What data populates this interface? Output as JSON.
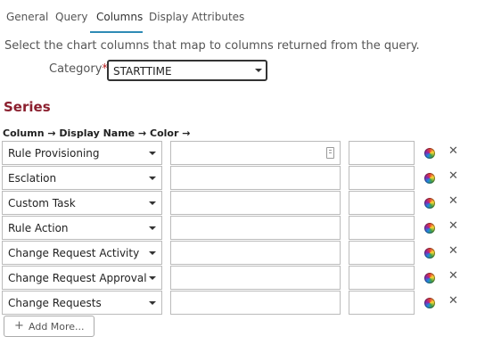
{
  "tabs": [
    {
      "label": "General"
    },
    {
      "label": "Query"
    },
    {
      "label": "Columns"
    },
    {
      "label": "Display Attributes"
    }
  ],
  "active_tab": "Columns",
  "intro_text": "Select the chart columns that map to columns returned from the query.",
  "category": {
    "label": "Category",
    "required_marker": "*",
    "suffix": ":",
    "selected_value": "STARTTIME"
  },
  "series": {
    "title": "Series",
    "column_headers": "Column → Display Name → Color →",
    "rows": [
      {
        "column": "Rule Provisioning",
        "display_name": "",
        "color": ""
      },
      {
        "column": "Esclation",
        "display_name": "",
        "color": ""
      },
      {
        "column": "Custom Task",
        "display_name": "",
        "color": ""
      },
      {
        "column": "Rule Action",
        "display_name": "",
        "color": ""
      },
      {
        "column": "Change Request Activity",
        "display_name": "",
        "color": ""
      },
      {
        "column": "Change Request Approval",
        "display_name": "",
        "color": ""
      },
      {
        "column": "Change Requests",
        "display_name": "",
        "color": ""
      }
    ],
    "remove_glyph": "✕",
    "add_more_icon": "plus-icon",
    "add_more_plus": "+",
    "add_more_label": "Add More..."
  },
  "colors": {
    "accent_underline": "#2e8bb5",
    "section_title": "#8b1f2e",
    "required_star": "#bb2222"
  }
}
